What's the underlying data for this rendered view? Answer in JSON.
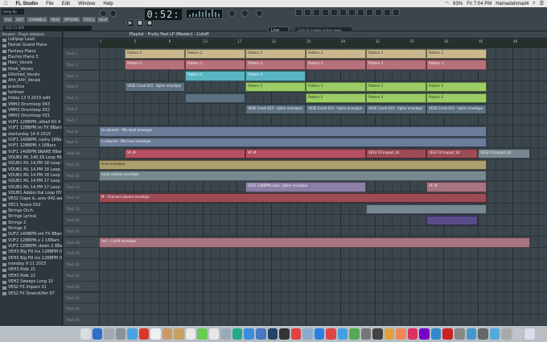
{
  "menubar": {
    "app": "FL Studio",
    "items": [
      "File",
      "Edit",
      "Window",
      "Help"
    ],
    "battery": "63%",
    "clock": "Fri 7:04 PM",
    "user": "Hamadahmad4"
  },
  "fl_menu": [
    "FILE",
    "EDIT",
    "CHANNELS",
    "VIEW",
    "OPTIONS",
    "TOOLS",
    "HELP"
  ],
  "file_name": "temp.flp",
  "hint_bar": "ADD 11 800",
  "transport": {
    "time": "0:52:",
    "play": "▶",
    "stop": "■",
    "rec": "●"
  },
  "right_hint": "Click to enable online news",
  "live_label": "Live",
  "browser": {
    "header": "Browser · Plugin database",
    "items": [
      "Lollipop Lead",
      "Fazrah Grand Piano",
      "Fantasy Piano",
      "Electro Piano 3",
      "Main_Vocals",
      "Hook_Vocals",
      "Glitched_Vocals",
      "Ahh_Ahh_Vocals",
      "practice",
      "hellman",
      "friday 13 9 2015 edit",
      "VMH2 Drumloop 043",
      "VMH2 Drumloop 032",
      "VMH2 Drumloop 031",
      "VUF1 128BPM..atball Kit 4",
      "VUF1 128BPM.mi FX 8Bars",
      "starturday 14 9 2015",
      "VUF1 140BPM..rushy 16Bars",
      "VUF1 128BPM..t 16Bars",
      "VUF1 140BPM.SNARE 8Bars",
      "VDUB1 ML 140.16 Loop Mix",
      "VDUB1 ML 14.PM 18 Loop 5",
      "VDUB1 ML 14.PM 18 Loop 2",
      "VDUB1 ML 14.PM 18 Loop 3",
      "VDUB1 ML 14.PM 17 Loop 2",
      "VDUB1 ML 14.PM 17 Loop 1",
      "VDUB1 Addon.Ital Loop 057",
      "VES2 Claps &..ares 042.wav",
      "VEC1 Snare 010",
      "Strings Orch.",
      "Strings Lyrical",
      "Strings 2",
      "Strings 3",
      "VUF2 140BPM.ork FX 8Bars",
      "VUF2 128BPM.u 1 16Bars",
      "VUF2 128BPM..down 2 8Bars",
      "VEH3 Big Fill Ins 128BPM 04",
      "VEH3 Big Fill Ins 128BPM 03",
      "monday 9 11 2015",
      "VEH3 Ride 21",
      "VEH3 Ride 22",
      "VEH2 Sweeps Long 10",
      "VES2 FX Impact 31",
      "VES2 FX DownsUfer 07"
    ]
  },
  "playlist": {
    "title": "Playlist - Fruity Fast LP (Master) - Cutoff",
    "snap": "Line",
    "ruler": [
      "1",
      "5",
      "9",
      "13",
      "17",
      "21",
      "25",
      "29",
      "33",
      "37",
      "41",
      "45",
      "49"
    ],
    "tracks": [
      "Track 1",
      "Track 2",
      "Track 3",
      "Track 4",
      "Track 5",
      "Track 6",
      "Track 7",
      "Track 8",
      "Track 9",
      "Track 10",
      "Track 11",
      "Track 12",
      "Track 13",
      "Track 14",
      "Track 15",
      "Track 16",
      "Track 17",
      "Track 18",
      "Track 19",
      "Track 20",
      "Track 21",
      "Track 22",
      "Track 23",
      "Track 24",
      "Track 25"
    ],
    "clip_labels": {
      "p2": "Pattern 2",
      "p3": "Pattern 3",
      "p4": "Pattern 4",
      "p5": "Pattern 5",
      "p6": "Pattern 6",
      "vesc": "VESE Crash 015 · Vpiler envelope",
      "mixvol": "(o volume) - Mix level envelope",
      "mixvol2": "o volume) - Mix level envelope",
      "impact": "VES2 FX Impact 34",
      "lvl": "level envelope",
      "evol": "vocal volume envelope",
      "vuf2": "VUF2 128BPM Lead...Vpiler envelope",
      "chan": "M - Channel volume envelope",
      "cutoff": "ter) - Cutoff envelope",
      "vf": "VF..M"
    }
  }
}
